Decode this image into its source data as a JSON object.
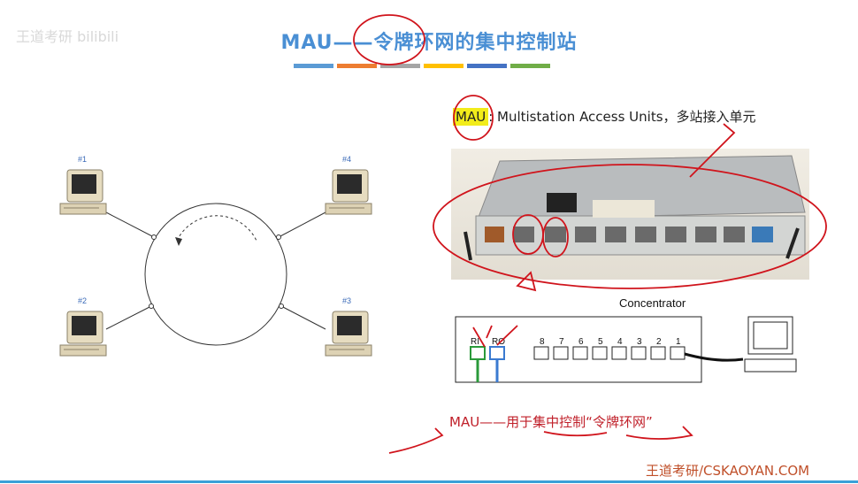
{
  "watermark": "王道考研 bilibili",
  "slide": {
    "title": "MAU——令牌环网的集中控制站",
    "bar_colors": [
      "#5b9bd5",
      "#ed7d31",
      "#a5a5a5",
      "#ffc000",
      "#4472c4",
      "#70ad47"
    ],
    "definition_abbr": "MAU",
    "definition_rest": ": Multistation Access Units，多站接入单元",
    "concentrator_label": "Concentrator",
    "bottom_note": "MAU——用于集中控制“令牌环网”",
    "footer": "王道考研/CSKAOYAN.COM"
  },
  "ring": {
    "stations": [
      "#1",
      "#4",
      "#2",
      "#3"
    ]
  },
  "concentrator": {
    "ports": [
      "8",
      "7",
      "6",
      "5",
      "4",
      "3",
      "2",
      "1"
    ],
    "ri": "RI",
    "ro": "RO"
  },
  "icons": {
    "computer": "computer-icon",
    "annotation": "red-ink-annotation"
  }
}
